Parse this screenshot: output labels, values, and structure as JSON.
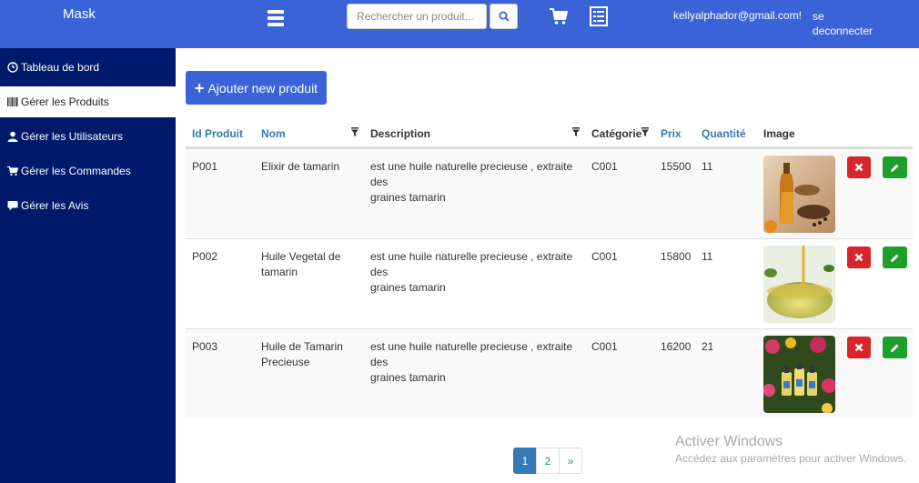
{
  "header": {
    "brand": "Mask",
    "search_placeholder": "Rechercher un produit...",
    "email": "kellyalphador@gmail.com!",
    "logout_label": "se deconnecter"
  },
  "sidebar": {
    "items": [
      {
        "label": "Tableau de bord",
        "icon": "clock-icon"
      },
      {
        "label": "Gérer les Produits",
        "icon": "barcode-icon",
        "active": true
      },
      {
        "label": "Gérer les Utilisateurs",
        "icon": "user-icon"
      },
      {
        "label": "Gérer les Commandes",
        "icon": "cart-icon"
      },
      {
        "label": "Gérer les Avis",
        "icon": "comment-icon"
      }
    ]
  },
  "main": {
    "add_label": "Ajouter new produit",
    "columns": {
      "id": "Id Produit",
      "nom": "Nom",
      "description": "Description",
      "categorie": "Catégorie",
      "prix": "Prix",
      "quantite": "Quantité",
      "image": "Image"
    },
    "rows": [
      {
        "id": "P001",
        "nom_1": "Elixir de tamarin",
        "nom_2": "",
        "desc_1": "est une huile naturelle precieuse , extraite des",
        "desc_2": "graines tamarin",
        "categorie": "C001",
        "prix": "15500",
        "quantite": "11"
      },
      {
        "id": "P002",
        "nom_1": "Huile Vegetal de",
        "nom_2": "tamarin",
        "desc_1": "est une huile naturelle precieuse , extraite des",
        "desc_2": "graines tamarin",
        "categorie": "C001",
        "prix": "15800",
        "quantite": "11"
      },
      {
        "id": "P003",
        "nom_1": "Huile de Tamarin",
        "nom_2": "Precieuse",
        "desc_1": "est une huile naturelle precieuse , extraite des",
        "desc_2": "graines tamarin",
        "categorie": "C001",
        "prix": "16200",
        "quantite": "21"
      }
    ],
    "pagination": [
      "1",
      "2",
      "»"
    ]
  },
  "watermark": {
    "title": "Activer Windows",
    "subtitle": "Accédez aux paramètres pour activer Windows."
  },
  "colors": {
    "header_bg": "#3a63d8",
    "sidebar_bg": "#001a6b",
    "link": "#337ab7",
    "delete": "#d9252a",
    "edit": "#1e9e2b"
  }
}
